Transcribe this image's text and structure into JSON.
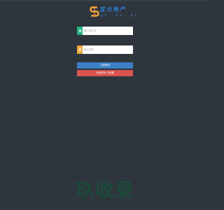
{
  "header": {
    "logo": {
      "title": "宝元地产",
      "subtitle": "园区 · 写字 · 商业"
    }
  },
  "login_form": {
    "username": {
      "badge_icon": "user-icon",
      "placeholder": "输入用户名",
      "value": ""
    },
    "password": {
      "badge_icon": "lock-icon",
      "placeholder": "输入密码",
      "value": ""
    },
    "login_button_label": "立即登录",
    "reset_button_label": "还未账号 去设置",
    "colors": {
      "username_badge": "#22b07d",
      "password_badge": "#f0a63a",
      "login_button": "#3d7fc4",
      "reset_button": "#d9534f"
    }
  },
  "watermark": {
    "text": "玖收录"
  },
  "theme": {
    "background": "#2f353d"
  }
}
